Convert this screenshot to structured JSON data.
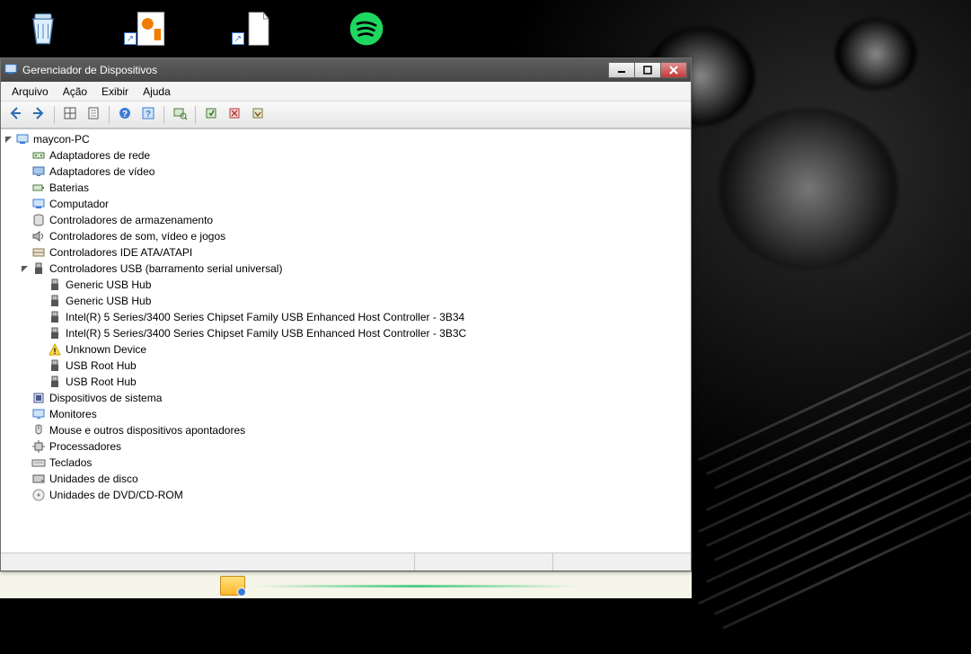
{
  "desktop": {
    "icons": [
      {
        "name": "recycle-bin",
        "glyph": "recycle"
      },
      {
        "name": "shortcut-1",
        "glyph": "orange-pad"
      },
      {
        "name": "shortcut-2",
        "glyph": "blank-doc"
      },
      {
        "name": "spotify",
        "glyph": "spotify"
      }
    ]
  },
  "window": {
    "title": "Gerenciador de Dispositivos",
    "menus": [
      "Arquivo",
      "Ação",
      "Exibir",
      "Ajuda"
    ],
    "toolbar": [
      {
        "name": "back-button",
        "icon": "arrow-left"
      },
      {
        "name": "forward-button",
        "icon": "arrow-right"
      },
      {
        "sep": true
      },
      {
        "name": "show-hidden-button",
        "icon": "grid"
      },
      {
        "name": "properties-button",
        "icon": "sheet"
      },
      {
        "sep": true
      },
      {
        "name": "help-button",
        "icon": "help"
      },
      {
        "name": "help-topics-button",
        "icon": "help-box"
      },
      {
        "sep": true
      },
      {
        "name": "scan-button",
        "icon": "scan"
      },
      {
        "sep": true
      },
      {
        "name": "update-driver-button",
        "icon": "chip-green"
      },
      {
        "name": "uninstall-button",
        "icon": "chip-x"
      },
      {
        "name": "disable-button",
        "icon": "chip-down"
      }
    ],
    "tree": {
      "root": {
        "label": "maycon-PC",
        "icon": "pc",
        "expanded": true
      },
      "children": [
        {
          "label": "Adaptadores de rede",
          "icon": "network",
          "expanded": false
        },
        {
          "label": "Adaptadores de vídeo",
          "icon": "display",
          "expanded": false
        },
        {
          "label": "Baterias",
          "icon": "battery",
          "expanded": false
        },
        {
          "label": "Computador",
          "icon": "pc",
          "expanded": false
        },
        {
          "label": "Controladores de armazenamento",
          "icon": "storage",
          "expanded": false
        },
        {
          "label": "Controladores de som, vídeo e jogos",
          "icon": "sound",
          "expanded": false
        },
        {
          "label": "Controladores IDE ATA/ATAPI",
          "icon": "ide",
          "expanded": false
        },
        {
          "label": "Controladores USB (barramento serial universal)",
          "icon": "usb",
          "expanded": true,
          "children": [
            {
              "label": "Generic USB Hub",
              "icon": "usb"
            },
            {
              "label": "Generic USB Hub",
              "icon": "usb"
            },
            {
              "label": "Intel(R) 5 Series/3400 Series Chipset Family USB Enhanced Host Controller - 3B34",
              "icon": "usb"
            },
            {
              "label": "Intel(R) 5 Series/3400 Series Chipset Family USB Enhanced Host Controller - 3B3C",
              "icon": "usb"
            },
            {
              "label": "Unknown Device",
              "icon": "warning"
            },
            {
              "label": "USB Root Hub",
              "icon": "usb"
            },
            {
              "label": "USB Root Hub",
              "icon": "usb"
            }
          ]
        },
        {
          "label": "Dispositivos de sistema",
          "icon": "system",
          "expanded": false
        },
        {
          "label": "Monitores",
          "icon": "monitor",
          "expanded": false
        },
        {
          "label": "Mouse e outros dispositivos apontadores",
          "icon": "mouse",
          "expanded": false
        },
        {
          "label": "Processadores",
          "icon": "cpu",
          "expanded": false
        },
        {
          "label": "Teclados",
          "icon": "keyboard",
          "expanded": false
        },
        {
          "label": "Unidades de disco",
          "icon": "disk",
          "expanded": false
        },
        {
          "label": "Unidades de DVD/CD-ROM",
          "icon": "cd",
          "expanded": false
        }
      ]
    }
  }
}
